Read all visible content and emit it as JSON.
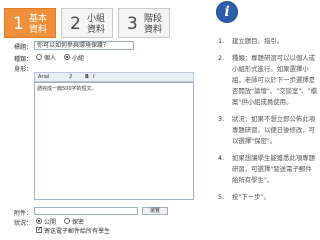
{
  "steps": [
    {
      "num": "1",
      "line1": "基本",
      "line2": "資料",
      "active": true
    },
    {
      "num": "2",
      "line1": "小組",
      "line2": "資料",
      "active": false
    },
    {
      "num": "3",
      "line1": "階段",
      "line2": "資料",
      "active": false
    }
  ],
  "info_icon": "i",
  "form": {
    "title_label": "標題：",
    "title_value": "你可以如何參與環境保護？",
    "type_label": "種類：",
    "type_options": [
      "個人",
      "小組"
    ],
    "type_selected": 1,
    "body_label": "身形：",
    "toolbar": {
      "font": "Arial",
      "size": "2",
      "bold": "B",
      "italic": "I"
    },
    "editor_text": "請完成一篇500字的短文。",
    "attach_label": "附件：",
    "browse_label": "瀏覽",
    "status_label": "狀況：",
    "status_options": [
      "公開",
      "保密"
    ],
    "notify_label": "寄送電子郵件給所有學生"
  },
  "instructions": [
    {
      "n": "1.",
      "text": "建立題目、指引。"
    },
    {
      "n": "2.",
      "text": "種類：專題研習可以以個人或小組形式進行。如果選擇小組，老師可以於下一步選擇是否開放\"論壇\"、\"交談室\"、\"檔案\"供小組成員使用。"
    },
    {
      "n": "3.",
      "text": "狀況：如果不想立即公佈此項專題研習，以便日後修改，可以選擇\"保密\"。"
    },
    {
      "n": "4.",
      "text": "如果想讓學生能獲悉此項專題研習，可選擇\"發送電子郵件給所有學生\"。"
    },
    {
      "n": "5.",
      "text": "按\"下一步\"。"
    }
  ]
}
